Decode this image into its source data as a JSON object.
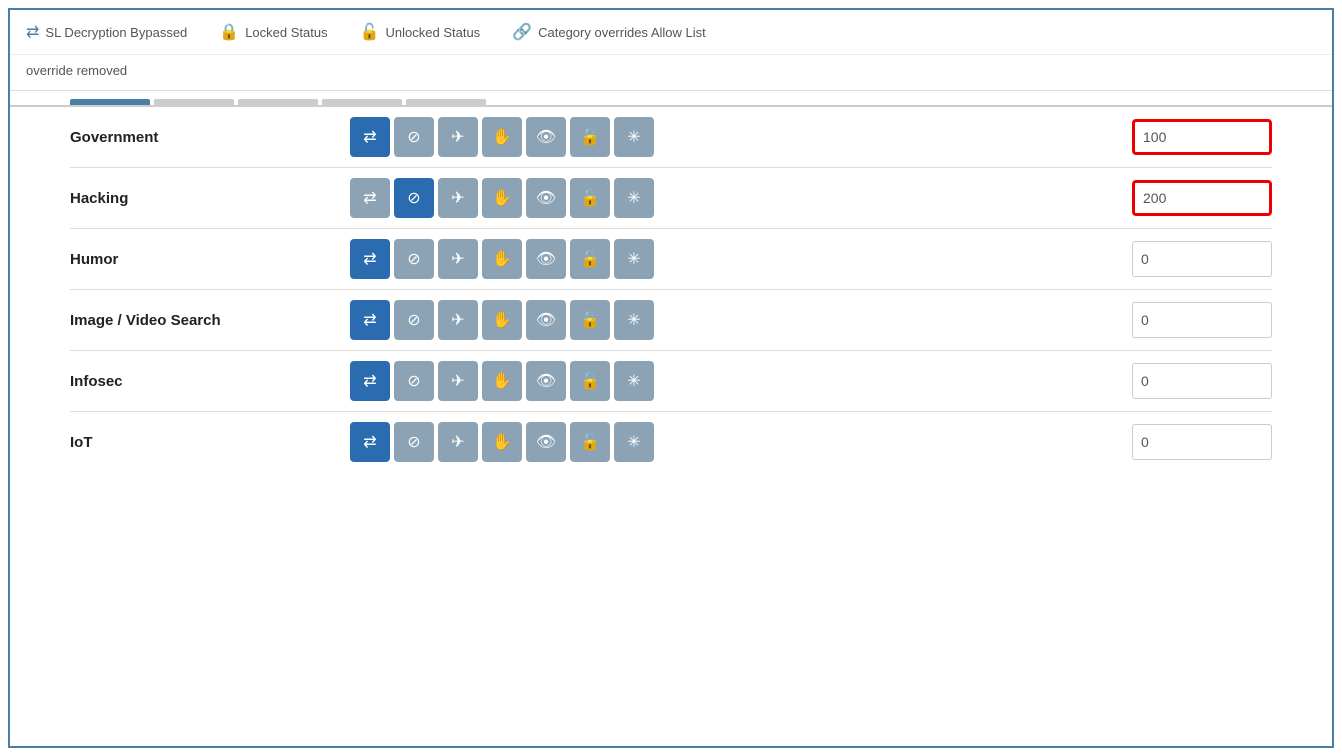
{
  "legend": {
    "items": [
      {
        "id": "ssl-bypass",
        "icon": "🔀",
        "label": "SL Decryption Bypassed"
      },
      {
        "id": "locked",
        "icon": "🔒",
        "label": "Locked Status"
      },
      {
        "id": "unlocked",
        "icon": "🔓",
        "label": "Unlocked Status"
      },
      {
        "id": "category-override",
        "icon": "🔗",
        "label": "Category overrides Allow List"
      }
    ]
  },
  "override_text": "override removed",
  "categories": [
    {
      "name": "Government",
      "active_button": 0,
      "value": "100",
      "highlighted": true
    },
    {
      "name": "Hacking",
      "active_button": 1,
      "value": "200",
      "highlighted": true
    },
    {
      "name": "Humor",
      "active_button": 0,
      "value": "0",
      "highlighted": false
    },
    {
      "name": "Image / Video Search",
      "active_button": 0,
      "value": "0",
      "highlighted": false
    },
    {
      "name": "Infosec",
      "active_button": 0,
      "value": "0",
      "highlighted": false
    },
    {
      "name": "IoT",
      "active_button": 0,
      "value": "0",
      "highlighted": false
    }
  ],
  "buttons": [
    {
      "icon": "⇄",
      "label": "transfer-icon"
    },
    {
      "icon": "⊘",
      "label": "block-icon"
    },
    {
      "icon": "✈",
      "label": "airplane-icon"
    },
    {
      "icon": "✋",
      "label": "hand-icon"
    },
    {
      "icon": "👁",
      "label": "eye-icon"
    },
    {
      "icon": "🔓",
      "label": "unlock-icon"
    },
    {
      "icon": "✳",
      "label": "asterisk-icon"
    }
  ]
}
